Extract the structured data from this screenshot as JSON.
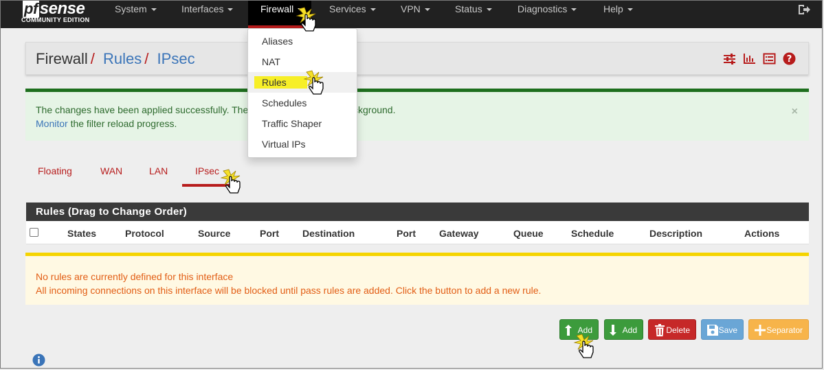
{
  "logo": {
    "word_pf": "pf",
    "word_rest": "sense",
    "subtitle": "COMMUNITY EDITION"
  },
  "nav": {
    "system": "System",
    "interfaces": "Interfaces",
    "firewall": "Firewall",
    "services": "Services",
    "vpn": "VPN",
    "status": "Status",
    "diagnostics": "Diagnostics",
    "help": "Help"
  },
  "dropdown": {
    "items": [
      "Aliases",
      "NAT",
      "Rules",
      "Schedules",
      "Traffic Shaper",
      "Virtual IPs"
    ]
  },
  "breadcrumb": {
    "part1": "Firewall",
    "part2": "Rules",
    "part3": "IPsec",
    "separator": "/"
  },
  "success_alert": {
    "line1_a": "The changes have been applied successfully. The",
    "line1_b": "loading in the background.",
    "monitor_link": "Monitor",
    "line2_rest": " the filter reload progress.",
    "close": "×"
  },
  "tabs": {
    "floating": "Floating",
    "wan": "WAN",
    "lan": "LAN",
    "ipsec": "IPsec"
  },
  "rules_table": {
    "title": "Rules (Drag to Change Order)",
    "columns": [
      "States",
      "Protocol",
      "Source",
      "Port",
      "Destination",
      "Port",
      "Gateway",
      "Queue",
      "Schedule",
      "Description",
      "Actions"
    ]
  },
  "warning_alert": {
    "line1": "No rules are currently defined for this interface",
    "line2": "All incoming connections on this interface will be blocked until pass rules are added. Click the button to add a new rule."
  },
  "buttons": {
    "add_top": "Add",
    "add_bottom": "Add",
    "delete": "Delete",
    "save": "Save",
    "separator": "Separator"
  },
  "colors": {
    "navbar": "#212121",
    "accent_red": "#b71c1c",
    "link_blue": "#3a74b8",
    "success_border": "#1e6f1e",
    "warning_border": "#f5d400",
    "warning_text": "#e25d14",
    "highlight_yellow": "#f7ef27"
  }
}
